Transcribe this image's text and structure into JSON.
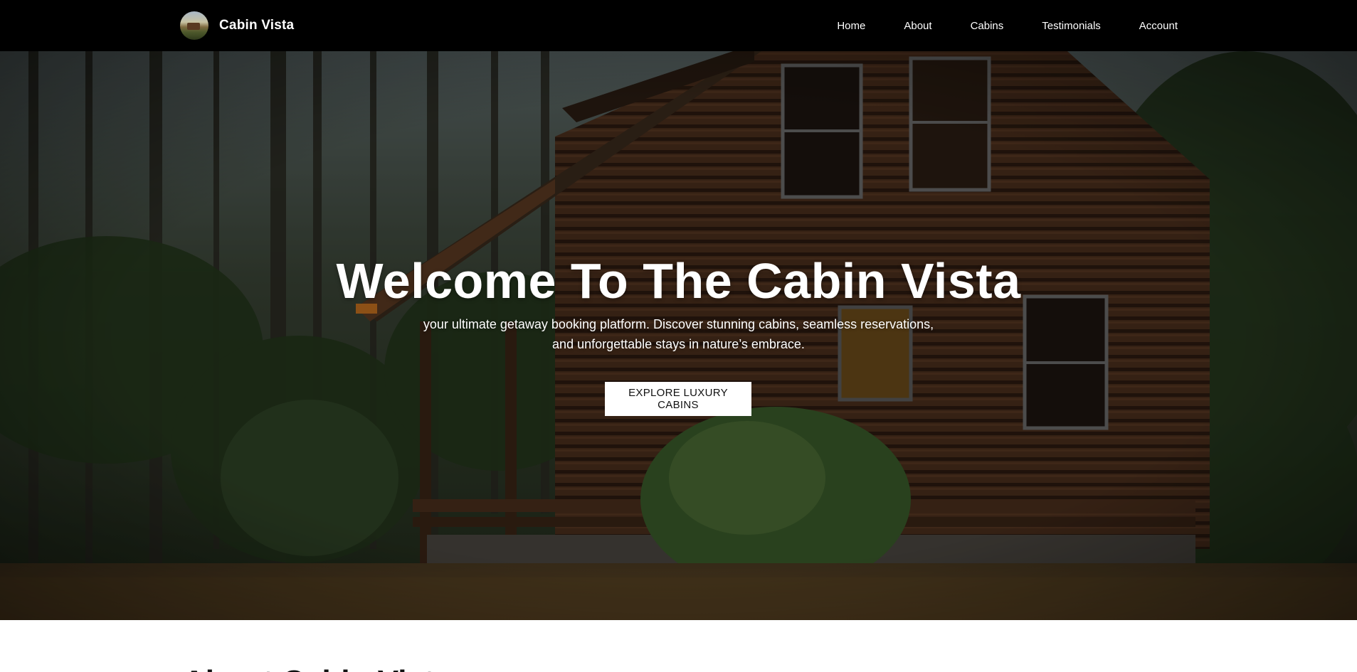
{
  "brand": {
    "name": "Cabin Vista",
    "logo_icon": "cabin-logo-icon"
  },
  "nav": {
    "items": [
      {
        "label": "Home"
      },
      {
        "label": "About"
      },
      {
        "label": "Cabins"
      },
      {
        "label": "Testimonials"
      },
      {
        "label": "Account"
      }
    ]
  },
  "hero": {
    "title": "Welcome To The Cabin Vista",
    "subtitle": "your ultimate getaway booking platform. Discover stunning cabins, seamless reservations, and unforgettable stays in nature’s embrace.",
    "cta_label": "EXPLORE LUXURY CABINS",
    "background": "log-cabin-in-forest-photo"
  },
  "about": {
    "heading": "About Cabin Vista"
  },
  "colors": {
    "navbar_bg": "#000000",
    "text_light": "#ffffff",
    "button_bg": "#ffffff",
    "button_text": "#111111"
  }
}
